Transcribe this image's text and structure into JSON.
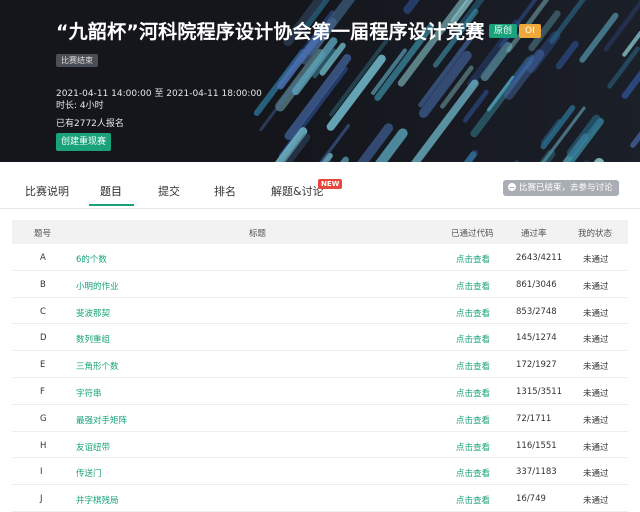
{
  "banner": {
    "title": "“九韶杯”河科院程序设计协会第一届程序设计竞赛",
    "tag_original": "原创",
    "tag_oi": "OI",
    "status_badge": "比赛结束",
    "time_text": "2021-04-11 14:00:00 至 2021-04-11 18:00:00",
    "duration_text": "时长: 4小时",
    "registered_text": "已有2772人报名",
    "replay_button": "创建重现赛",
    "colors": {
      "accent": "#1aa37a",
      "oi": "#f0a83a",
      "background": "#14161c"
    }
  },
  "nav": {
    "tabs": [
      {
        "label": "比赛说明"
      },
      {
        "label": "题目"
      },
      {
        "label": "提交"
      },
      {
        "label": "排名"
      },
      {
        "label": "解题&讨论"
      }
    ],
    "active_tab": "题目",
    "new_badge": "NEW",
    "ended_notice": "比赛已结束，去参与讨论"
  },
  "table": {
    "headers": {
      "id": "题号",
      "title": "标题",
      "passed_code": "已通过代码",
      "pass_rate": "通过率",
      "my_status": "我的状态"
    },
    "rows": [
      {
        "id": "A",
        "title": "6的个数",
        "code": "点击查看",
        "rate": "2643/4211",
        "status": "未通过"
      },
      {
        "id": "B",
        "title": "小明的作业",
        "code": "点击查看",
        "rate": "861/3046",
        "status": "未通过"
      },
      {
        "id": "C",
        "title": "斐波那契",
        "code": "点击查看",
        "rate": "853/2748",
        "status": "未通过"
      },
      {
        "id": "D",
        "title": "数列重组",
        "code": "点击查看",
        "rate": "145/1274",
        "status": "未通过"
      },
      {
        "id": "E",
        "title": "三角形个数",
        "code": "点击查看",
        "rate": "172/1927",
        "status": "未通过"
      },
      {
        "id": "F",
        "title": "字符串",
        "code": "点击查看",
        "rate": "1315/3511",
        "status": "未通过"
      },
      {
        "id": "G",
        "title": "最强对手矩阵",
        "code": "点击查看",
        "rate": "72/1711",
        "status": "未通过"
      },
      {
        "id": "H",
        "title": "友谊纽带",
        "code": "点击查看",
        "rate": "116/1551",
        "status": "未通过"
      },
      {
        "id": "I",
        "title": "传送门",
        "code": "点击查看",
        "rate": "337/1183",
        "status": "未通过"
      },
      {
        "id": "J",
        "title": "井字棋残局",
        "code": "点击查看",
        "rate": "16/749",
        "status": "未通过"
      }
    ]
  }
}
